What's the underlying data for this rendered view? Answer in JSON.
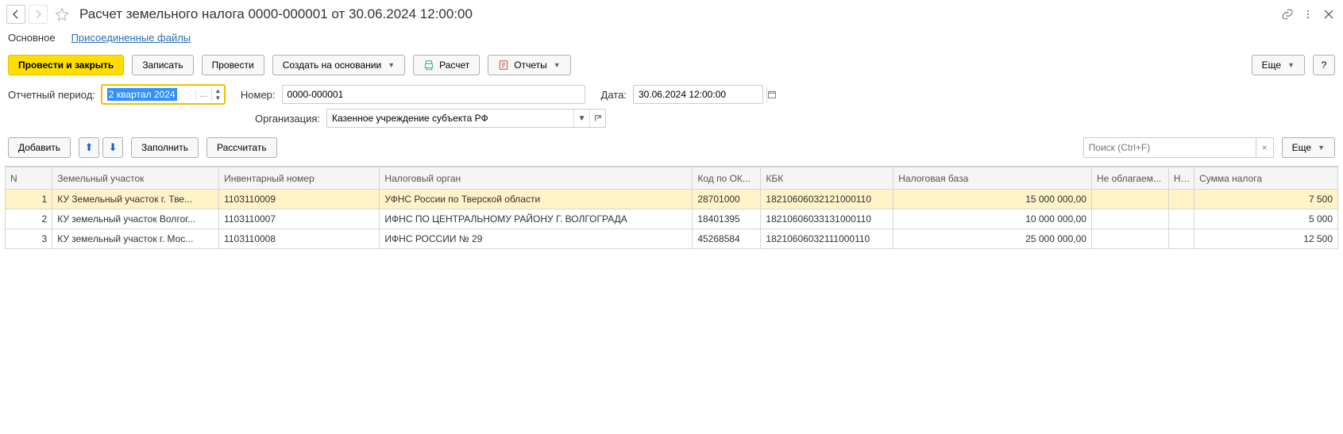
{
  "header": {
    "title": "Расчет земельного налога 0000-000001 от 30.06.2024 12:00:00"
  },
  "tabs": {
    "main": "Основное",
    "files": "Присоединенные файлы"
  },
  "toolbar": {
    "save_close": "Провести и закрыть",
    "save": "Записать",
    "post": "Провести",
    "create_based": "Создать на основании",
    "calc": "Расчет",
    "reports": "Отчеты",
    "more": "Еще",
    "help": "?"
  },
  "form": {
    "period_label": "Отчетный период:",
    "period_value": "2 квартал 2024",
    "number_label": "Номер:",
    "number_value": "0000-000001",
    "date_label": "Дата:",
    "date_value": "30.06.2024 12:00:00",
    "org_label": "Организация:",
    "org_value": "Казенное учреждение субъекта РФ"
  },
  "subtoolbar": {
    "add": "Добавить",
    "fill": "Заполнить",
    "recalc": "Рассчитать",
    "search_placeholder": "Поиск (Ctrl+F)",
    "more": "Еще"
  },
  "table": {
    "headers": {
      "n": "N",
      "land": "Земельный участок",
      "inv": "Инвентарный номер",
      "tax_office": "Налоговый орган",
      "oktmo": "Код по ОК...",
      "kbk": "КБК",
      "base": "Налоговая база",
      "exempt": "Не облагаем...",
      "rate": "Нал",
      "sum": "Сумма налога"
    },
    "rows": [
      {
        "n": "1",
        "land": "КУ Земельный участок г. Тве...",
        "inv": "1103110009",
        "tax_office": "УФНС России по Тверской области",
        "oktmo": "28701000",
        "kbk": "18210606032121000110",
        "base": "15 000 000,00",
        "exempt": "",
        "rate": "",
        "sum": "7 500"
      },
      {
        "n": "2",
        "land": "КУ земельный участок Волгог...",
        "inv": "1103110007",
        "tax_office": "ИФНС ПО ЦЕНТРАЛЬНОМУ РАЙОНУ Г. ВОЛГОГРАДА",
        "oktmo": "18401395",
        "kbk": "18210606033131000110",
        "base": "10 000 000,00",
        "exempt": "",
        "rate": "",
        "sum": "5 000"
      },
      {
        "n": "3",
        "land": "КУ земельный участок г. Мос...",
        "inv": "1103110008",
        "tax_office": "ИФНС РОССИИ № 29",
        "oktmo": "45268584",
        "kbk": "18210606032111000110",
        "base": "25 000 000,00",
        "exempt": "",
        "rate": "",
        "sum": "12 500"
      }
    ]
  }
}
